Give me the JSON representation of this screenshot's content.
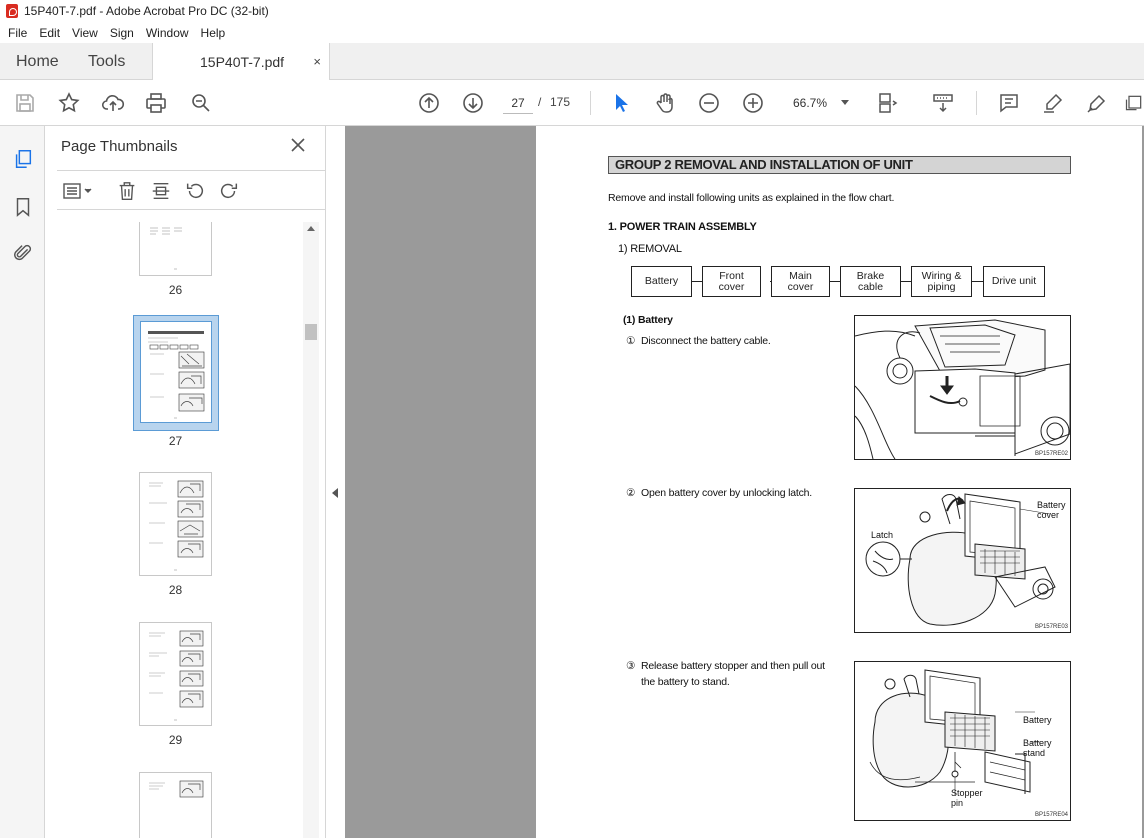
{
  "window": {
    "title": "15P40T-7.pdf - Adobe Acrobat Pro DC (32-bit)"
  },
  "menu": [
    "File",
    "Edit",
    "View",
    "Sign",
    "Window",
    "Help"
  ],
  "tabs": {
    "home": "Home",
    "tools": "Tools",
    "doc": "15P40T-7.pdf",
    "doc_close": "×"
  },
  "toolbar": {
    "page_current": "27",
    "page_sep": "/",
    "page_total": "175",
    "zoom": "66.7%"
  },
  "thumbnails": {
    "title": "Page Thumbnails",
    "close": "×",
    "pages": [
      "26",
      "27",
      "28",
      "29"
    ],
    "selected": "27"
  },
  "document": {
    "group_title": "GROUP  2  REMOVAL AND INSTALLATION OF UNIT",
    "intro": "Remove and install following units as explained in the flow chart.",
    "section": "1. POWER TRAIN ASSEMBLY",
    "subsection": "1) REMOVAL",
    "flow": [
      "Battery",
      "Front cover",
      "Main cover",
      "Brake cable",
      "Wiring & piping",
      "Drive unit"
    ],
    "step_heading": "(1) Battery",
    "steps": [
      {
        "num": "①",
        "text": "Disconnect the battery cable."
      },
      {
        "num": "②",
        "text": "Open battery cover by unlocking latch."
      },
      {
        "num": "③",
        "text": "Release battery stopper and then pull out",
        "text2": "the battery to stand."
      }
    ],
    "figures": [
      {
        "caption": "BP157RE02",
        "labels": []
      },
      {
        "caption": "BP157RE03",
        "labels": [
          "Battery cover",
          "Latch"
        ]
      },
      {
        "caption": "BP157RE04",
        "labels": [
          "Battery",
          "Battery stand",
          "Stopper pin"
        ]
      }
    ]
  }
}
